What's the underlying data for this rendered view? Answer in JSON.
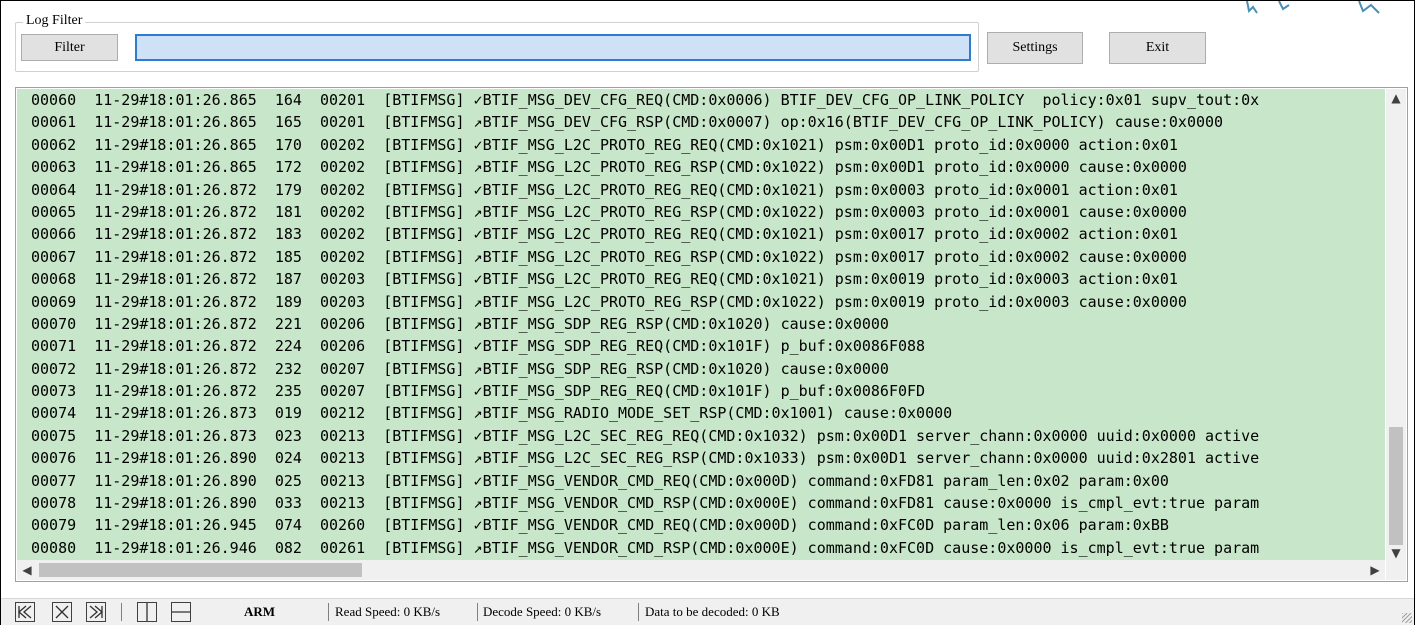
{
  "filter": {
    "group_title": "Log Filter",
    "button_label": "Filter",
    "input_value": ""
  },
  "toolbar": {
    "settings_label": "Settings",
    "exit_label": "Exit"
  },
  "log_rows": [
    {
      "id": "00060",
      "time": "11-29#18:01:26.865",
      "seq": "164",
      "code": "00201",
      "tag": "[BTIFMSG]",
      "dir": "✓",
      "msg": "BTIF_MSG_DEV_CFG_REQ(CMD:0x0006) BTIF_DEV_CFG_OP_LINK_POLICY  policy:0x01 supv_tout:0x"
    },
    {
      "id": "00061",
      "time": "11-29#18:01:26.865",
      "seq": "165",
      "code": "00201",
      "tag": "[BTIFMSG]",
      "dir": "↗",
      "msg": "BTIF_MSG_DEV_CFG_RSP(CMD:0x0007) op:0x16(BTIF_DEV_CFG_OP_LINK_POLICY) cause:0x0000"
    },
    {
      "id": "00062",
      "time": "11-29#18:01:26.865",
      "seq": "170",
      "code": "00202",
      "tag": "[BTIFMSG]",
      "dir": "✓",
      "msg": "BTIF_MSG_L2C_PROTO_REG_REQ(CMD:0x1021) psm:0x00D1 proto_id:0x0000 action:0x01"
    },
    {
      "id": "00063",
      "time": "11-29#18:01:26.865",
      "seq": "172",
      "code": "00202",
      "tag": "[BTIFMSG]",
      "dir": "↗",
      "msg": "BTIF_MSG_L2C_PROTO_REG_RSP(CMD:0x1022) psm:0x00D1 proto_id:0x0000 cause:0x0000"
    },
    {
      "id": "00064",
      "time": "11-29#18:01:26.872",
      "seq": "179",
      "code": "00202",
      "tag": "[BTIFMSG]",
      "dir": "✓",
      "msg": "BTIF_MSG_L2C_PROTO_REG_REQ(CMD:0x1021) psm:0x0003 proto_id:0x0001 action:0x01"
    },
    {
      "id": "00065",
      "time": "11-29#18:01:26.872",
      "seq": "181",
      "code": "00202",
      "tag": "[BTIFMSG]",
      "dir": "↗",
      "msg": "BTIF_MSG_L2C_PROTO_REG_RSP(CMD:0x1022) psm:0x0003 proto_id:0x0001 cause:0x0000"
    },
    {
      "id": "00066",
      "time": "11-29#18:01:26.872",
      "seq": "183",
      "code": "00202",
      "tag": "[BTIFMSG]",
      "dir": "✓",
      "msg": "BTIF_MSG_L2C_PROTO_REG_REQ(CMD:0x1021) psm:0x0017 proto_id:0x0002 action:0x01"
    },
    {
      "id": "00067",
      "time": "11-29#18:01:26.872",
      "seq": "185",
      "code": "00202",
      "tag": "[BTIFMSG]",
      "dir": "↗",
      "msg": "BTIF_MSG_L2C_PROTO_REG_RSP(CMD:0x1022) psm:0x0017 proto_id:0x0002 cause:0x0000"
    },
    {
      "id": "00068",
      "time": "11-29#18:01:26.872",
      "seq": "187",
      "code": "00203",
      "tag": "[BTIFMSG]",
      "dir": "✓",
      "msg": "BTIF_MSG_L2C_PROTO_REG_REQ(CMD:0x1021) psm:0x0019 proto_id:0x0003 action:0x01"
    },
    {
      "id": "00069",
      "time": "11-29#18:01:26.872",
      "seq": "189",
      "code": "00203",
      "tag": "[BTIFMSG]",
      "dir": "↗",
      "msg": "BTIF_MSG_L2C_PROTO_REG_RSP(CMD:0x1022) psm:0x0019 proto_id:0x0003 cause:0x0000"
    },
    {
      "id": "00070",
      "time": "11-29#18:01:26.872",
      "seq": "221",
      "code": "00206",
      "tag": "[BTIFMSG]",
      "dir": "↗",
      "msg": "BTIF_MSG_SDP_REG_RSP(CMD:0x1020) cause:0x0000"
    },
    {
      "id": "00071",
      "time": "11-29#18:01:26.872",
      "seq": "224",
      "code": "00206",
      "tag": "[BTIFMSG]",
      "dir": "✓",
      "msg": "BTIF_MSG_SDP_REG_REQ(CMD:0x101F) p_buf:0x0086F088"
    },
    {
      "id": "00072",
      "time": "11-29#18:01:26.872",
      "seq": "232",
      "code": "00207",
      "tag": "[BTIFMSG]",
      "dir": "↗",
      "msg": "BTIF_MSG_SDP_REG_RSP(CMD:0x1020) cause:0x0000"
    },
    {
      "id": "00073",
      "time": "11-29#18:01:26.872",
      "seq": "235",
      "code": "00207",
      "tag": "[BTIFMSG]",
      "dir": "✓",
      "msg": "BTIF_MSG_SDP_REG_REQ(CMD:0x101F) p_buf:0x0086F0FD"
    },
    {
      "id": "00074",
      "time": "11-29#18:01:26.873",
      "seq": "019",
      "code": "00212",
      "tag": "[BTIFMSG]",
      "dir": "↗",
      "msg": "BTIF_MSG_RADIO_MODE_SET_RSP(CMD:0x1001) cause:0x0000"
    },
    {
      "id": "00075",
      "time": "11-29#18:01:26.873",
      "seq": "023",
      "code": "00213",
      "tag": "[BTIFMSG]",
      "dir": "✓",
      "msg": "BTIF_MSG_L2C_SEC_REG_REQ(CMD:0x1032) psm:0x00D1 server_chann:0x0000 uuid:0x0000 active"
    },
    {
      "id": "00076",
      "time": "11-29#18:01:26.890",
      "seq": "024",
      "code": "00213",
      "tag": "[BTIFMSG]",
      "dir": "↗",
      "msg": "BTIF_MSG_L2C_SEC_REG_RSP(CMD:0x1033) psm:0x00D1 server_chann:0x0000 uuid:0x2801 active"
    },
    {
      "id": "00077",
      "time": "11-29#18:01:26.890",
      "seq": "025",
      "code": "00213",
      "tag": "[BTIFMSG]",
      "dir": "✓",
      "msg": "BTIF_MSG_VENDOR_CMD_REQ(CMD:0x000D) command:0xFD81 param_len:0x02 param:0x00"
    },
    {
      "id": "00078",
      "time": "11-29#18:01:26.890",
      "seq": "033",
      "code": "00213",
      "tag": "[BTIFMSG]",
      "dir": "↗",
      "msg": "BTIF_MSG_VENDOR_CMD_RSP(CMD:0x000E) command:0xFD81 cause:0x0000 is_cmpl_evt:true param"
    },
    {
      "id": "00079",
      "time": "11-29#18:01:26.945",
      "seq": "074",
      "code": "00260",
      "tag": "[BTIFMSG]",
      "dir": "✓",
      "msg": "BTIF_MSG_VENDOR_CMD_REQ(CMD:0x000D) command:0xFC0D param_len:0x06 param:0xBB"
    },
    {
      "id": "00080",
      "time": "11-29#18:01:26.946",
      "seq": "082",
      "code": "00261",
      "tag": "[BTIFMSG]",
      "dir": "↗",
      "msg": "BTIF_MSG_VENDOR_CMD_RSP(CMD:0x000E) command:0xFC0D cause:0x0000 is_cmpl_evt:true param"
    }
  ],
  "statusbar": {
    "arch": "ARM",
    "read_speed": "Read Speed:  0 KB/s",
    "decode_speed": "Decode Speed:  0 KB/s",
    "data_to_decode": "Data to be decoded:  0 KB"
  },
  "icons": {
    "first": "skip-first-icon",
    "stop": "stop-box-icon",
    "last": "skip-last-icon",
    "split_vertical": "split-vertical-icon",
    "split_horizontal": "split-horizontal-icon"
  },
  "colors": {
    "log_background": "#c8e6c9",
    "input_highlight": "#cfe1f7",
    "input_border": "#2f7bd0"
  }
}
